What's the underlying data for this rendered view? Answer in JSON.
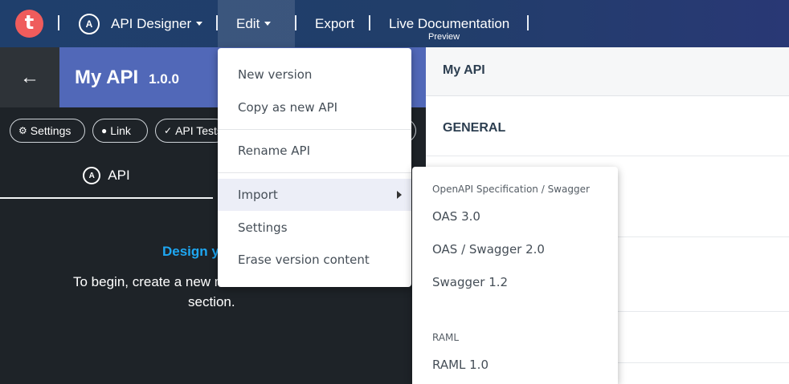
{
  "topnav": {
    "logo_letter": "t",
    "designer_icon": "A",
    "api_designer_label": "API Designer",
    "edit_label": "Edit",
    "export_label": "Export",
    "live_docs_label": "Live Documentation",
    "live_docs_sub": "Preview"
  },
  "api": {
    "name": "My API",
    "version": "1.0.0",
    "back_icon": "←"
  },
  "pills": {
    "settings_icon": "⚙",
    "settings": "Settings",
    "link_icon": "●",
    "link": "Link",
    "tests_icon": "✓",
    "tests": "API Tests"
  },
  "tabs": {
    "api_icon": "A",
    "api": "API"
  },
  "design": {
    "title": "Design y",
    "line1": "To begin, create a new m",
    "line2": "section."
  },
  "right": {
    "title": "My API",
    "general": "GENERAL"
  },
  "edit_menu": {
    "new_version": "New version",
    "copy_as_new": "Copy as new API",
    "rename": "Rename API",
    "import": "Import",
    "settings": "Settings",
    "erase": "Erase version content"
  },
  "import_menu": {
    "openapi_header": "OpenAPI Specification / Swagger",
    "oas3": "OAS 3.0",
    "oas2": "OAS / Swagger 2.0",
    "swagger12": "Swagger 1.2",
    "raml_header": "RAML",
    "raml10": "RAML 1.0"
  },
  "colors": {
    "nav_bg": "#213e6a",
    "api_header_bg": "#5168b8",
    "accent_blue": "#1ea7f2",
    "logo": "#ef5c5c"
  }
}
